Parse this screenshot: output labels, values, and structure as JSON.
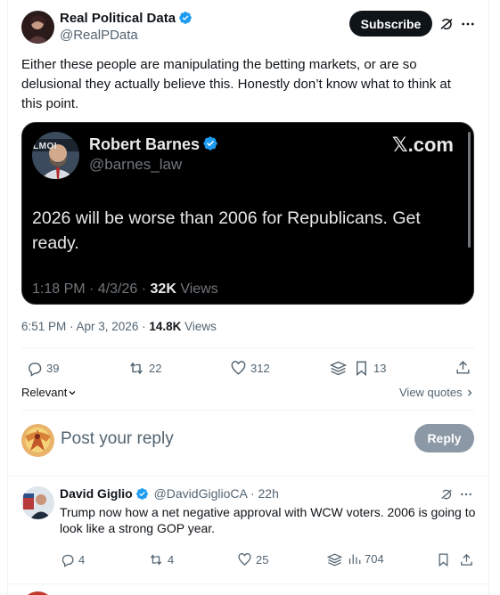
{
  "post": {
    "author_name": "Real Political Data",
    "author_handle": "@RealPData",
    "subscribe_label": "Subscribe",
    "text": "Either these people are manipulating the betting markets, or are so delusional they actually believe this. Honestly don’t know what to think at this point.",
    "time": "6:51 PM · Apr 3, 2026 · ",
    "views_count": "14.8K",
    "views_label": " Views"
  },
  "quoted": {
    "author_name": "Robert Barnes",
    "author_handle": "@barnes_law",
    "source": "𝕏.com",
    "text": "2026 will be worse than 2006 for Republicans. Get ready.",
    "time": "1:18 PM · 4/3/26 · ",
    "views_count": "32K",
    "views_label": " Views",
    "avatar_text": "LMOI"
  },
  "actions": {
    "replies": "39",
    "reposts": "22",
    "likes": "312",
    "bookmarks": "13"
  },
  "sort": {
    "relevant_label": "Relevant",
    "view_quotes_label": "View quotes"
  },
  "composer": {
    "placeholder": "Post your reply",
    "reply_label": "Reply"
  },
  "reply": {
    "author_name": "David Giglio",
    "author_handle": "@DavidGiglioCA",
    "time": " · 22h",
    "text": "Trump now how a net negative approval with WCW voters. 2006 is going to look like a strong GOP year.",
    "replies": "4",
    "reposts": "4",
    "likes": "25",
    "views": "704"
  },
  "colors": {
    "verified": "#1d9bf0",
    "text_primary": "#0f1419",
    "text_secondary": "#536471",
    "embed_bg": "#000000"
  },
  "icons": [
    "verified-badge-icon",
    "grok-icon",
    "more-icon",
    "reply-icon",
    "repost-icon",
    "like-icon",
    "views-icon",
    "bookmark-icon",
    "share-icon",
    "chevron-down-icon",
    "chevron-right-icon"
  ]
}
